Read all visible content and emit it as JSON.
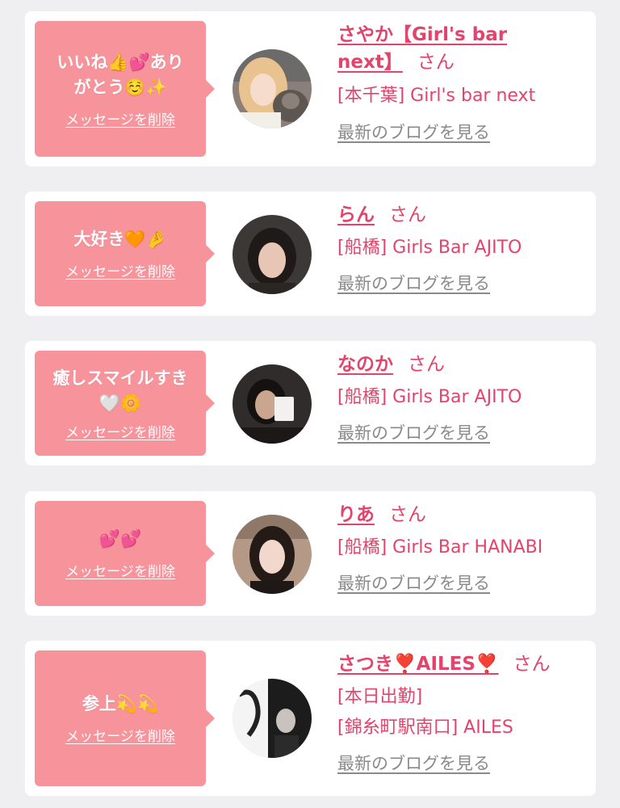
{
  "cards": [
    {
      "message_lines": [
        "いいね👍💕あり",
        "がとう☺️✨"
      ],
      "delete_label": "メッセージを削除",
      "name_lines": [
        "さやか【Girl's bar",
        "next】"
      ],
      "honorific": "さん",
      "shop_lines": [
        "[本千葉] Girl's bar next"
      ],
      "blog_label": "最新のブログを見る"
    },
    {
      "message_lines": [
        "大好き🧡🤌"
      ],
      "delete_label": "メッセージを削除",
      "name_lines": [
        "らん"
      ],
      "honorific": "さん",
      "shop_lines": [
        "[船橋] Girls Bar AJITO"
      ],
      "blog_label": "最新のブログを見る"
    },
    {
      "message_lines": [
        "癒しスマイルすき",
        "🤍🌼"
      ],
      "delete_label": "メッセージを削除",
      "name_lines": [
        "なのか"
      ],
      "honorific": "さん",
      "shop_lines": [
        "[船橋] Girls Bar AJITO"
      ],
      "blog_label": "最新のブログを見る"
    },
    {
      "message_lines": [
        "💕💕"
      ],
      "delete_label": "メッセージを削除",
      "name_lines": [
        "りあ"
      ],
      "honorific": "さん",
      "shop_lines": [
        "[船橋] Girls Bar HANABI"
      ],
      "blog_label": "最新のブログを見る"
    },
    {
      "message_lines": [
        "参上💫💫"
      ],
      "delete_label": "メッセージを削除",
      "name_lines": [
        "さつき❣️AILES❣️"
      ],
      "honorific": "さん",
      "shop_lines": [
        "[本日出勤]",
        "[錦糸町駅南口] AILES"
      ],
      "blog_label": "最新のブログを見る"
    }
  ],
  "colors": {
    "page_bg": "#efeff1",
    "bubble_bg": "#f7939b",
    "accent": "#e4436b",
    "link_gray": "#8a8a8a"
  }
}
